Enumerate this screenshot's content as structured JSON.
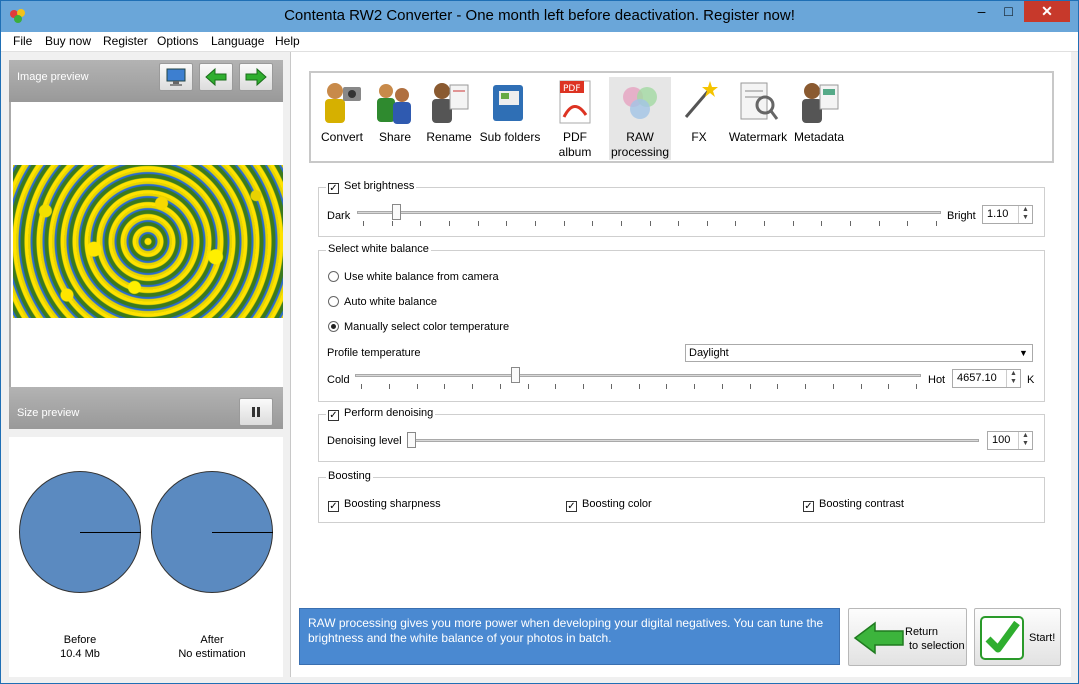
{
  "window": {
    "title": "Contenta RW2 Converter  - One month left before deactivation. Register now!",
    "min": "–",
    "max": "□",
    "close": "✕"
  },
  "menu": [
    "File",
    "Buy now",
    "Register",
    "Options",
    "Language",
    "Help"
  ],
  "left": {
    "image_preview_label": "Image preview",
    "size_preview_label": "Size preview",
    "before_label": "Before",
    "before_value": "10.4 Mb",
    "after_label": "After",
    "after_value": "No estimation"
  },
  "toolbar": {
    "items": [
      {
        "label": "Convert",
        "icon": "convert-icon"
      },
      {
        "label": "Share",
        "icon": "share-icon"
      },
      {
        "label": "Rename",
        "icon": "rename-icon"
      },
      {
        "label": "Sub folders",
        "icon": "subfolders-icon"
      },
      {
        "label": "PDF album",
        "icon": "pdf-album-icon"
      },
      {
        "label": "RAW processing",
        "label_line1": "RAW",
        "label_line2": "processing",
        "icon": "raw-processing-icon",
        "active": true
      },
      {
        "label": "FX",
        "icon": "fx-icon"
      },
      {
        "label": "Watermark",
        "icon": "watermark-icon"
      },
      {
        "label": "Metadata",
        "icon": "metadata-icon"
      }
    ]
  },
  "brightness": {
    "checkbox_label": "Set brightness",
    "checked": true,
    "left_label": "Dark",
    "right_label": "Bright",
    "value": "1.10",
    "slider_fraction": 0.06
  },
  "white_balance": {
    "title": "Select white balance",
    "options": [
      {
        "label": "Use white balance from camera",
        "selected": false
      },
      {
        "label": "Auto white balance",
        "selected": false
      },
      {
        "label": "Manually select color temperature",
        "selected": true
      }
    ],
    "profile_label": "Profile temperature",
    "profile_value": "Daylight",
    "left_label": "Cold",
    "right_label": "Hot",
    "value": "4657.10",
    "unit": "K",
    "slider_fraction": 0.28
  },
  "denoising": {
    "checkbox_label": "Perform denoising",
    "checked": true,
    "level_label": "Denoising level",
    "value": "100",
    "slider_fraction": 0.0
  },
  "boosting": {
    "title": "Boosting",
    "sharpness": "Boosting sharpness",
    "color": "Boosting color",
    "contrast": "Boosting contrast"
  },
  "info_text": "RAW processing gives you more power when developing your digital negatives. You can tune the brightness and the white balance of your photos in batch.",
  "buttons": {
    "return_line1": "Return",
    "return_line2": "to selection",
    "start": "Start!"
  },
  "colors": {
    "titlebar": "#6aa6d9",
    "info_box": "#4a89d1",
    "pie": "#5b8ac0",
    "close": "#c7392b"
  }
}
